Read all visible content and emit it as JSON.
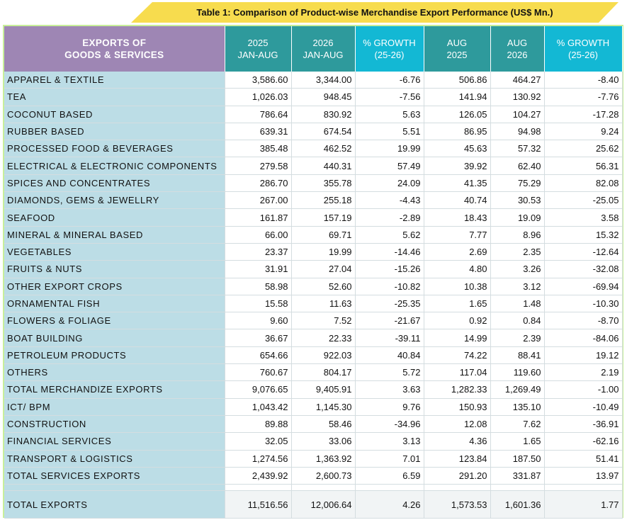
{
  "title": "Table 1: Comparison of Product-wise Merchandise Export Performance (US$ Mn.)",
  "colors": {
    "banner": "#f7dc4e",
    "header_purple": "#9e86b4",
    "header_teal": "#2e9a9c",
    "header_cyan": "#13b8d4",
    "row_label": "#bcdde6",
    "border": "#c8ef9a"
  },
  "headers": [
    [
      "EXPORTS OF",
      "GOODS & SERVICES"
    ],
    [
      "2025",
      "JAN-AUG"
    ],
    [
      "2026",
      "JAN-AUG"
    ],
    [
      "% GROWTH",
      "(25-26)"
    ],
    [
      "AUG",
      "2025"
    ],
    [
      "AUG",
      "2026"
    ],
    [
      "% GROWTH",
      "(25-26)"
    ]
  ],
  "rows": [
    [
      "APPAREL & TEXTILE",
      "3,586.60",
      "3,344.00",
      "-6.76",
      "506.86",
      "464.27",
      "-8.40"
    ],
    [
      "TEA",
      "1,026.03",
      "948.45",
      "-7.56",
      "141.94",
      "130.92",
      "-7.76"
    ],
    [
      "COCONUT BASED",
      "786.64",
      "830.92",
      "5.63",
      "126.05",
      "104.27",
      "-17.28"
    ],
    [
      "RUBBER BASED",
      "639.31",
      "674.54",
      "5.51",
      "86.95",
      "94.98",
      "9.24"
    ],
    [
      "PROCESSED FOOD & BEVERAGES",
      "385.48",
      "462.52",
      "19.99",
      "45.63",
      "57.32",
      "25.62"
    ],
    [
      "ELECTRICAL & ELECTRONIC   COMPONENTS",
      "279.58",
      "440.31",
      "57.49",
      "39.92",
      "62.40",
      "56.31"
    ],
    [
      "SPICES AND CONCENTRATES",
      "286.70",
      "355.78",
      "24.09",
      "41.35",
      "75.29",
      "82.08"
    ],
    [
      "DIAMONDS, GEMS & JEWELLRY",
      "267.00",
      "255.18",
      "-4.43",
      "40.74",
      "30.53",
      "-25.05"
    ],
    [
      "SEAFOOD",
      "161.87",
      "157.19",
      "-2.89",
      "18.43",
      "19.09",
      "3.58"
    ],
    [
      "MINERAL & MINERAL BASED",
      "66.00",
      "69.71",
      "5.62",
      "7.77",
      "8.96",
      "15.32"
    ],
    [
      "VEGETABLES",
      "23.37",
      "19.99",
      "-14.46",
      "2.69",
      "2.35",
      "-12.64"
    ],
    [
      "FRUITS & NUTS",
      "31.91",
      "27.04",
      "-15.26",
      "4.80",
      "3.26",
      "-32.08"
    ],
    [
      "OTHER EXPORT CROPS",
      "58.98",
      "52.60",
      "-10.82",
      "10.38",
      "3.12",
      "-69.94"
    ],
    [
      "ORNAMENTAL FISH",
      "15.58",
      "11.63",
      "-25.35",
      "1.65",
      "1.48",
      "-10.30"
    ],
    [
      "FLOWERS & FOLIAGE",
      "9.60",
      "7.52",
      "-21.67",
      "0.92",
      "0.84",
      "-8.70"
    ],
    [
      "BOAT BUILDING",
      "36.67",
      "22.33",
      "-39.11",
      "14.99",
      "2.39",
      "-84.06"
    ],
    [
      "PETROLEUM PRODUCTS",
      "654.66",
      "922.03",
      "40.84",
      "74.22",
      "88.41",
      "19.12"
    ],
    [
      "OTHERS",
      "760.67",
      "804.17",
      "5.72",
      "117.04",
      "119.60",
      "2.19"
    ],
    [
      "TOTAL MERCHANDIZE EXPORTS",
      "9,076.65",
      "9,405.91",
      "3.63",
      "1,282.33",
      "1,269.49",
      "-1.00"
    ],
    [
      "ICT/ BPM",
      "1,043.42",
      "1,145.30",
      "9.76",
      "150.93",
      "135.10",
      "-10.49"
    ],
    [
      "CONSTRUCTION",
      "89.88",
      "58.46",
      "-34.96",
      "12.08",
      "7.62",
      "-36.91"
    ],
    [
      "FINANCIAL  SERVICES",
      "32.05",
      "33.06",
      "3.13",
      "4.36",
      "1.65",
      "-62.16"
    ],
    [
      "TRANSPORT  & LOGISTICS",
      "1,274.56",
      "1,363.92",
      "7.01",
      "123.84",
      "187.50",
      "51.41"
    ],
    [
      "TOTAL SERVICES EXPORTS",
      "2,439.92",
      "2,600.73",
      "6.59",
      "291.20",
      "331.87",
      "13.97"
    ]
  ],
  "total": [
    "TOTAL EXPORTS",
    "11,516.56",
    "12,006.64",
    "4.26",
    "1,573.53",
    "1,601.36",
    "1.77"
  ]
}
